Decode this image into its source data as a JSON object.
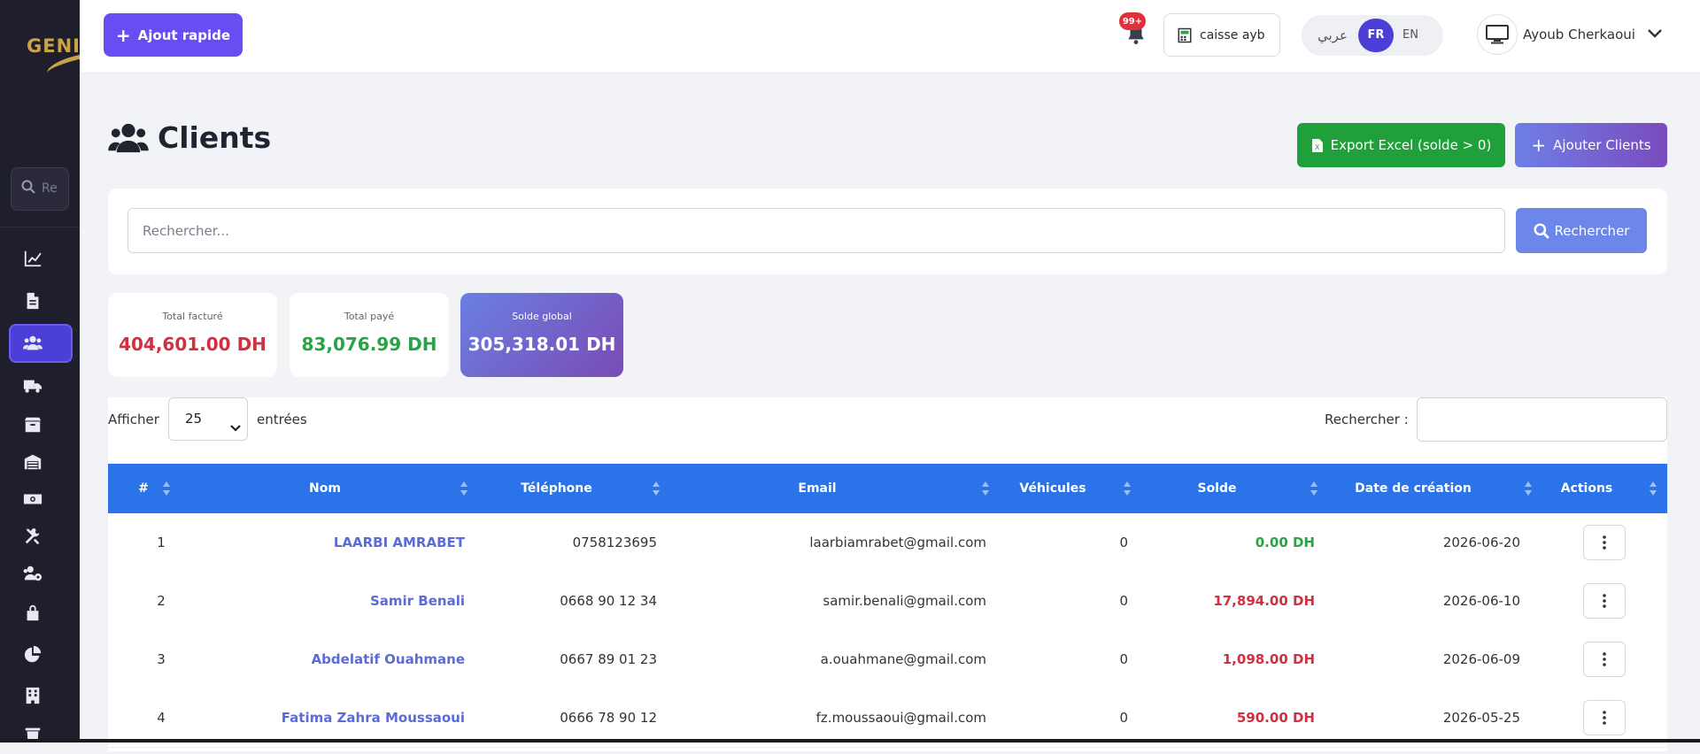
{
  "sidebar": {
    "logo_text": "GENIS",
    "search_placeholder": "Re",
    "items": [
      {
        "name": "dashboard",
        "icon": "chart-line-icon"
      },
      {
        "name": "documents",
        "icon": "file-icon"
      },
      {
        "name": "clients",
        "icon": "users-icon",
        "active": true
      },
      {
        "name": "deliveries",
        "icon": "truck-icon"
      },
      {
        "name": "products",
        "icon": "box-icon"
      },
      {
        "name": "warehouse",
        "icon": "warehouse-icon"
      },
      {
        "name": "cash",
        "icon": "money-icon"
      },
      {
        "name": "tools",
        "icon": "tools-icon"
      },
      {
        "name": "staff",
        "icon": "users-gear-icon"
      },
      {
        "name": "security",
        "icon": "lock-icon"
      },
      {
        "name": "reports",
        "icon": "pie-chart-icon"
      },
      {
        "name": "company",
        "icon": "building-icon"
      },
      {
        "name": "trash",
        "icon": "trash-icon"
      }
    ]
  },
  "header": {
    "quick_add_label": "Ajout rapide",
    "notif_badge": "99+",
    "caisse_label": "caisse ayb",
    "lang": {
      "ar": "عربي",
      "fr": "FR",
      "en": "EN",
      "active": "FR"
    },
    "user_name": "Ayoub Cherkaoui"
  },
  "page": {
    "title": "Clients",
    "export_label": "Export Excel (solde > 0)",
    "add_label": "Ajouter Clients"
  },
  "search": {
    "placeholder": "Rechercher...",
    "button_label": "Rechercher"
  },
  "stats": {
    "total_facture": {
      "label": "Total facturé",
      "value": "404,601.00 DH"
    },
    "total_paye": {
      "label": "Total payé",
      "value": "83,076.99 DH"
    },
    "solde_global": {
      "label": "Solde global",
      "value": "305,318.01 DH"
    }
  },
  "table": {
    "show_label": "Afficher",
    "page_size": "25",
    "entries_label": "entrées",
    "filter_label": "Rechercher :",
    "headers": [
      "#",
      "Nom",
      "Téléphone",
      "Email",
      "Véhicules",
      "Solde",
      "Date de création",
      "Actions"
    ],
    "rows": [
      {
        "num": "1",
        "nom": "LAARBI AMRABET",
        "tel": "0758123695",
        "email": "laarbiamrabet@gmail.com",
        "veh": "0",
        "solde": "0.00 DH",
        "date": "2026-06-20"
      },
      {
        "num": "2",
        "nom": "Samir Benali",
        "tel": "0668 90 12 34",
        "email": "samir.benali@gmail.com",
        "veh": "0",
        "solde": "17,894.00 DH",
        "date": "2026-06-10"
      },
      {
        "num": "3",
        "nom": "Abdelatif Ouahmane",
        "tel": "0667 89 01 23",
        "email": "a.ouahmane@gmail.com",
        "veh": "0",
        "solde": "1,098.00 DH",
        "date": "2026-06-09"
      },
      {
        "num": "4",
        "nom": "Fatima Zahra Moussaoui",
        "tel": "0666 78 90 12",
        "email": "fz.moussaoui@gmail.com",
        "veh": "0",
        "solde": "590.00 DH",
        "date": "2026-05-25"
      }
    ]
  },
  "colors": {
    "sidebar_bg": "#1e1e2d",
    "accent": "#6a4df2",
    "table_header": "#2a73e8",
    "positive": "#27a545",
    "negative": "#d22f3f"
  }
}
